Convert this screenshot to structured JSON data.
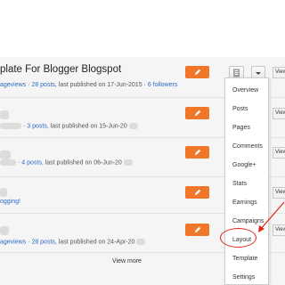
{
  "blogs": [
    {
      "title": "plate For Blogger Blogspot",
      "pageviews": "ageviews",
      "posts": "28 posts",
      "published": "last published on 17-Jun-2015",
      "followers": "6 followers"
    },
    {
      "posts": "3 posts",
      "published": "last published on 15-Jun-20"
    },
    {
      "posts": "4 posts",
      "published": "last published on 06-Jun-20"
    },
    {
      "text": "ogging!"
    },
    {
      "pageviews": "ageviews",
      "posts": "28 posts",
      "published": "last published on 24-Apr-20"
    }
  ],
  "view_label": "View",
  "separator": "·",
  "menu": {
    "items": [
      "Overview",
      "Posts",
      "Pages",
      "Comments",
      "Google+",
      "Stats",
      "Earnings",
      "Campaigns",
      "Layout",
      "Template",
      "Settings"
    ]
  },
  "view_more": "View more",
  "colors": {
    "edit_button": "#f0772a",
    "link": "#2a6ac8",
    "highlight": "#e0251b"
  },
  "icons": {
    "edit": "pencil-icon",
    "doc": "document-icon",
    "dropdown": "caret-down-icon"
  }
}
